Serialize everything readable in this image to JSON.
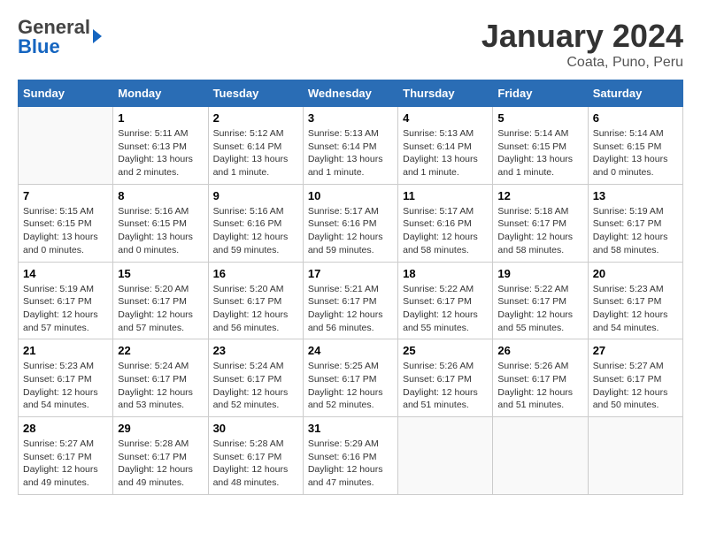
{
  "header": {
    "logo_general": "General",
    "logo_blue": "Blue",
    "title": "January 2024",
    "location": "Coata, Puno, Peru"
  },
  "weekdays": [
    "Sunday",
    "Monday",
    "Tuesday",
    "Wednesday",
    "Thursday",
    "Friday",
    "Saturday"
  ],
  "weeks": [
    [
      {
        "day": "",
        "sunrise": "",
        "sunset": "",
        "daylight": ""
      },
      {
        "day": "1",
        "sunrise": "Sunrise: 5:11 AM",
        "sunset": "Sunset: 6:13 PM",
        "daylight": "Daylight: 13 hours and 2 minutes."
      },
      {
        "day": "2",
        "sunrise": "Sunrise: 5:12 AM",
        "sunset": "Sunset: 6:14 PM",
        "daylight": "Daylight: 13 hours and 1 minute."
      },
      {
        "day": "3",
        "sunrise": "Sunrise: 5:13 AM",
        "sunset": "Sunset: 6:14 PM",
        "daylight": "Daylight: 13 hours and 1 minute."
      },
      {
        "day": "4",
        "sunrise": "Sunrise: 5:13 AM",
        "sunset": "Sunset: 6:14 PM",
        "daylight": "Daylight: 13 hours and 1 minute."
      },
      {
        "day": "5",
        "sunrise": "Sunrise: 5:14 AM",
        "sunset": "Sunset: 6:15 PM",
        "daylight": "Daylight: 13 hours and 1 minute."
      },
      {
        "day": "6",
        "sunrise": "Sunrise: 5:14 AM",
        "sunset": "Sunset: 6:15 PM",
        "daylight": "Daylight: 13 hours and 0 minutes."
      }
    ],
    [
      {
        "day": "7",
        "sunrise": "Sunrise: 5:15 AM",
        "sunset": "Sunset: 6:15 PM",
        "daylight": "Daylight: 13 hours and 0 minutes."
      },
      {
        "day": "8",
        "sunrise": "Sunrise: 5:16 AM",
        "sunset": "Sunset: 6:15 PM",
        "daylight": "Daylight: 13 hours and 0 minutes."
      },
      {
        "day": "9",
        "sunrise": "Sunrise: 5:16 AM",
        "sunset": "Sunset: 6:16 PM",
        "daylight": "Daylight: 12 hours and 59 minutes."
      },
      {
        "day": "10",
        "sunrise": "Sunrise: 5:17 AM",
        "sunset": "Sunset: 6:16 PM",
        "daylight": "Daylight: 12 hours and 59 minutes."
      },
      {
        "day": "11",
        "sunrise": "Sunrise: 5:17 AM",
        "sunset": "Sunset: 6:16 PM",
        "daylight": "Daylight: 12 hours and 58 minutes."
      },
      {
        "day": "12",
        "sunrise": "Sunrise: 5:18 AM",
        "sunset": "Sunset: 6:17 PM",
        "daylight": "Daylight: 12 hours and 58 minutes."
      },
      {
        "day": "13",
        "sunrise": "Sunrise: 5:19 AM",
        "sunset": "Sunset: 6:17 PM",
        "daylight": "Daylight: 12 hours and 58 minutes."
      }
    ],
    [
      {
        "day": "14",
        "sunrise": "Sunrise: 5:19 AM",
        "sunset": "Sunset: 6:17 PM",
        "daylight": "Daylight: 12 hours and 57 minutes."
      },
      {
        "day": "15",
        "sunrise": "Sunrise: 5:20 AM",
        "sunset": "Sunset: 6:17 PM",
        "daylight": "Daylight: 12 hours and 57 minutes."
      },
      {
        "day": "16",
        "sunrise": "Sunrise: 5:20 AM",
        "sunset": "Sunset: 6:17 PM",
        "daylight": "Daylight: 12 hours and 56 minutes."
      },
      {
        "day": "17",
        "sunrise": "Sunrise: 5:21 AM",
        "sunset": "Sunset: 6:17 PM",
        "daylight": "Daylight: 12 hours and 56 minutes."
      },
      {
        "day": "18",
        "sunrise": "Sunrise: 5:22 AM",
        "sunset": "Sunset: 6:17 PM",
        "daylight": "Daylight: 12 hours and 55 minutes."
      },
      {
        "day": "19",
        "sunrise": "Sunrise: 5:22 AM",
        "sunset": "Sunset: 6:17 PM",
        "daylight": "Daylight: 12 hours and 55 minutes."
      },
      {
        "day": "20",
        "sunrise": "Sunrise: 5:23 AM",
        "sunset": "Sunset: 6:17 PM",
        "daylight": "Daylight: 12 hours and 54 minutes."
      }
    ],
    [
      {
        "day": "21",
        "sunrise": "Sunrise: 5:23 AM",
        "sunset": "Sunset: 6:17 PM",
        "daylight": "Daylight: 12 hours and 54 minutes."
      },
      {
        "day": "22",
        "sunrise": "Sunrise: 5:24 AM",
        "sunset": "Sunset: 6:17 PM",
        "daylight": "Daylight: 12 hours and 53 minutes."
      },
      {
        "day": "23",
        "sunrise": "Sunrise: 5:24 AM",
        "sunset": "Sunset: 6:17 PM",
        "daylight": "Daylight: 12 hours and 52 minutes."
      },
      {
        "day": "24",
        "sunrise": "Sunrise: 5:25 AM",
        "sunset": "Sunset: 6:17 PM",
        "daylight": "Daylight: 12 hours and 52 minutes."
      },
      {
        "day": "25",
        "sunrise": "Sunrise: 5:26 AM",
        "sunset": "Sunset: 6:17 PM",
        "daylight": "Daylight: 12 hours and 51 minutes."
      },
      {
        "day": "26",
        "sunrise": "Sunrise: 5:26 AM",
        "sunset": "Sunset: 6:17 PM",
        "daylight": "Daylight: 12 hours and 51 minutes."
      },
      {
        "day": "27",
        "sunrise": "Sunrise: 5:27 AM",
        "sunset": "Sunset: 6:17 PM",
        "daylight": "Daylight: 12 hours and 50 minutes."
      }
    ],
    [
      {
        "day": "28",
        "sunrise": "Sunrise: 5:27 AM",
        "sunset": "Sunset: 6:17 PM",
        "daylight": "Daylight: 12 hours and 49 minutes."
      },
      {
        "day": "29",
        "sunrise": "Sunrise: 5:28 AM",
        "sunset": "Sunset: 6:17 PM",
        "daylight": "Daylight: 12 hours and 49 minutes."
      },
      {
        "day": "30",
        "sunrise": "Sunrise: 5:28 AM",
        "sunset": "Sunset: 6:17 PM",
        "daylight": "Daylight: 12 hours and 48 minutes."
      },
      {
        "day": "31",
        "sunrise": "Sunrise: 5:29 AM",
        "sunset": "Sunset: 6:16 PM",
        "daylight": "Daylight: 12 hours and 47 minutes."
      },
      {
        "day": "",
        "sunrise": "",
        "sunset": "",
        "daylight": ""
      },
      {
        "day": "",
        "sunrise": "",
        "sunset": "",
        "daylight": ""
      },
      {
        "day": "",
        "sunrise": "",
        "sunset": "",
        "daylight": ""
      }
    ]
  ]
}
